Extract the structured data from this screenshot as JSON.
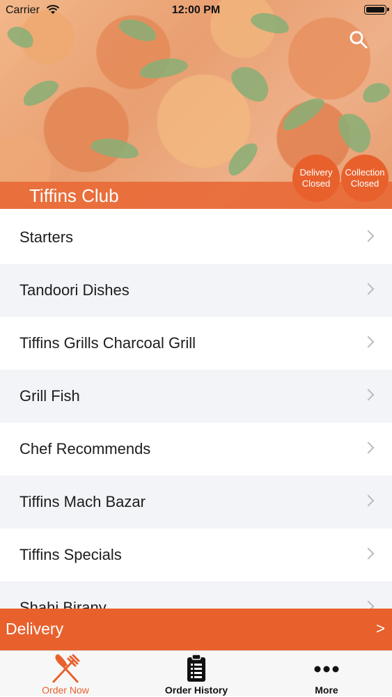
{
  "status_bar": {
    "carrier": "Carrier",
    "time": "12:00 PM"
  },
  "header": {
    "restaurant_name": "Tiffins Club",
    "delivery_status": {
      "line1": "Delivery",
      "line2": "Closed"
    },
    "collection_status": {
      "line1": "Collection",
      "line2": "Closed"
    }
  },
  "menu": {
    "items": [
      {
        "label": "Starters"
      },
      {
        "label": "Tandoori Dishes"
      },
      {
        "label": "Tiffins Grills Charcoal Grill"
      },
      {
        "label": "Grill Fish"
      },
      {
        "label": "Chef Recommends"
      },
      {
        "label": "Tiffins Mach Bazar"
      },
      {
        "label": "Tiffins Specials"
      },
      {
        "label": "Shahi Birany"
      }
    ]
  },
  "order_bar": {
    "label": "Delivery",
    "arrow": ">"
  },
  "tabs": [
    {
      "label": "Order Now",
      "icon": "fork-knife-icon",
      "active": true
    },
    {
      "label": "Order History",
      "icon": "clipboard-icon",
      "active": false
    },
    {
      "label": "More",
      "icon": "more-dots-icon",
      "active": false
    }
  ],
  "colors": {
    "accent": "#e8612d",
    "alt_row": "#f2f4f8",
    "tab_bar_bg": "#f7f7f7"
  }
}
